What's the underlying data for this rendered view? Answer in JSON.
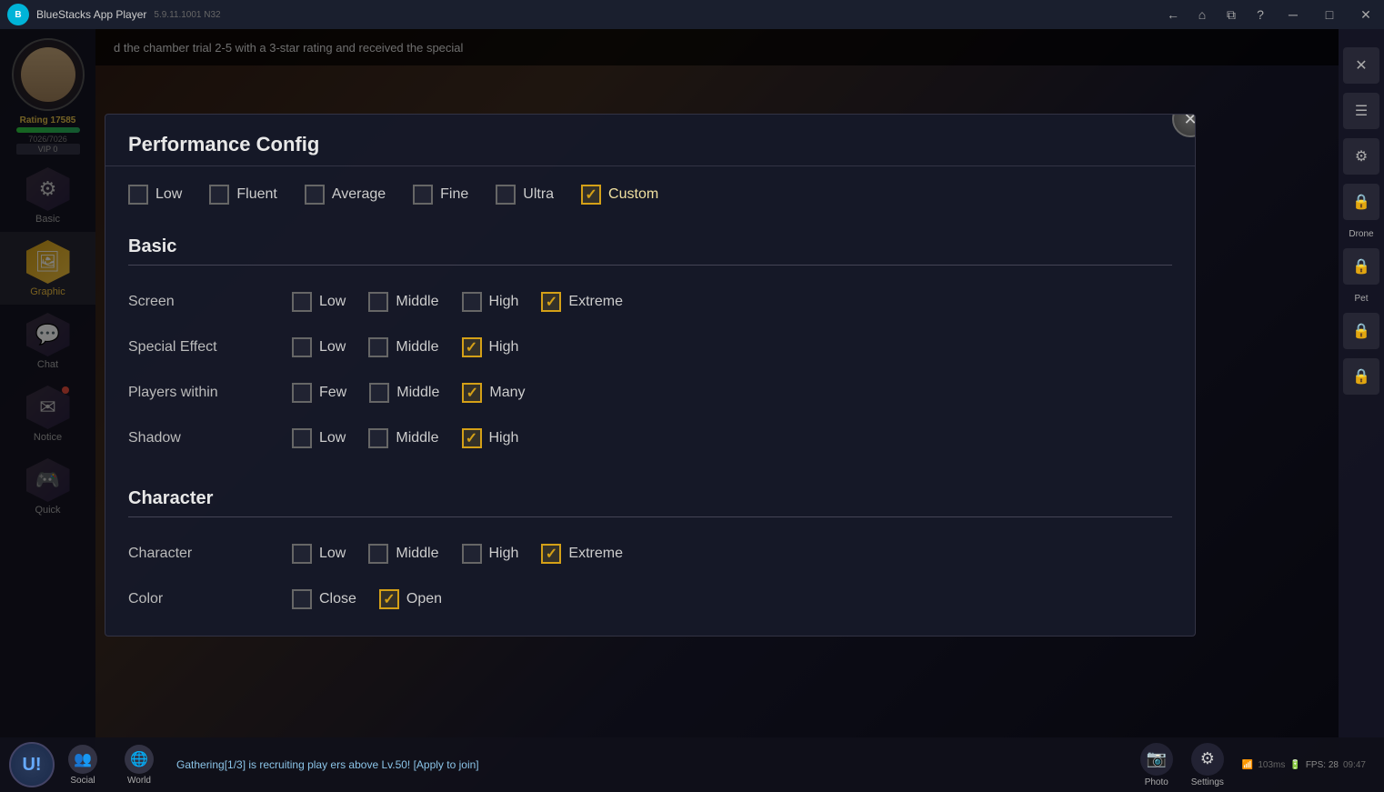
{
  "app": {
    "title": "BlueStacks App Player",
    "version": "5.9.11.1001 N32",
    "close_btn": "✕",
    "minimize_btn": "─",
    "maximize_btn": "□",
    "help_btn": "?",
    "back_icon": "←",
    "home_icon": "⌂",
    "recent_icon": "⧉"
  },
  "titlebar": {
    "title": "BlueStacks App Player",
    "version": "5.9.11.1001 N32"
  },
  "player": {
    "rating_label": "Rating",
    "rating": "17585",
    "hp_current": "7026",
    "hp_max": "7026",
    "vip": "VIP 0"
  },
  "notification": {
    "text": "d the chamber trial 2-5 with a 3-star rating and received the special"
  },
  "left_nav": {
    "items": [
      {
        "id": "basic",
        "label": "Basic",
        "icon": "⚙",
        "active": false
      },
      {
        "id": "graphic",
        "label": "Graphic",
        "icon": "🖼",
        "active": true
      },
      {
        "id": "chat",
        "label": "Chat",
        "icon": "💬",
        "active": false
      },
      {
        "id": "notice",
        "label": "Notice",
        "icon": "✉",
        "active": false
      },
      {
        "id": "quick",
        "label": "Quick",
        "icon": "🎮",
        "active": false
      }
    ]
  },
  "right_nav": {
    "items": [
      {
        "id": "close-x",
        "icon": "✕",
        "locked": false
      },
      {
        "id": "nav1",
        "icon": "☰",
        "locked": false
      },
      {
        "id": "nav2",
        "icon": "⚙",
        "locked": true
      },
      {
        "id": "nav3",
        "icon": "🔒",
        "locked": true
      },
      {
        "id": "drone",
        "label": "Drone",
        "icon": "🔒",
        "locked": true
      },
      {
        "id": "pet",
        "label": "Pet",
        "icon": "🔒",
        "locked": true
      },
      {
        "id": "nav6",
        "icon": "🔒",
        "locked": true
      }
    ]
  },
  "modal": {
    "title": "Performance Config",
    "close_btn": "✕",
    "presets": [
      {
        "id": "low",
        "label": "Low",
        "checked": false
      },
      {
        "id": "fluent",
        "label": "Fluent",
        "checked": false
      },
      {
        "id": "average",
        "label": "Average",
        "checked": false
      },
      {
        "id": "fine",
        "label": "Fine",
        "checked": false
      },
      {
        "id": "ultra",
        "label": "Ultra",
        "checked": false
      },
      {
        "id": "custom",
        "label": "Custom",
        "checked": true
      }
    ],
    "sections": {
      "basic": {
        "title": "Basic",
        "rows": [
          {
            "id": "screen",
            "label": "Screen",
            "options": [
              {
                "id": "low",
                "label": "Low",
                "checked": false
              },
              {
                "id": "middle",
                "label": "Middle",
                "checked": false
              },
              {
                "id": "high",
                "label": "High",
                "checked": false
              },
              {
                "id": "extreme",
                "label": "Extreme",
                "checked": true
              }
            ]
          },
          {
            "id": "special_effect",
            "label": "Special Effect",
            "options": [
              {
                "id": "low",
                "label": "Low",
                "checked": false
              },
              {
                "id": "middle",
                "label": "Middle",
                "checked": false
              },
              {
                "id": "high",
                "label": "High",
                "checked": true
              }
            ]
          },
          {
            "id": "players_within",
            "label": "Players within",
            "options": [
              {
                "id": "few",
                "label": "Few",
                "checked": false
              },
              {
                "id": "middle",
                "label": "Middle",
                "checked": false
              },
              {
                "id": "many",
                "label": "Many",
                "checked": true
              }
            ]
          },
          {
            "id": "shadow",
            "label": "Shadow",
            "options": [
              {
                "id": "low",
                "label": "Low",
                "checked": false
              },
              {
                "id": "middle",
                "label": "Middle",
                "checked": false
              },
              {
                "id": "high",
                "label": "High",
                "checked": true
              }
            ]
          }
        ]
      },
      "character": {
        "title": "Character",
        "rows": [
          {
            "id": "character",
            "label": "Character",
            "options": [
              {
                "id": "low",
                "label": "Low",
                "checked": false
              },
              {
                "id": "middle",
                "label": "Middle",
                "checked": false
              },
              {
                "id": "high",
                "label": "High",
                "checked": false
              },
              {
                "id": "extreme",
                "label": "Extreme",
                "checked": true
              }
            ]
          },
          {
            "id": "color",
            "label": "Color",
            "options": [
              {
                "id": "close",
                "label": "Close",
                "checked": false
              },
              {
                "id": "open",
                "label": "Open",
                "checked": true
              }
            ]
          }
        ]
      }
    }
  },
  "bottom": {
    "social_label": "Social",
    "world_label": "World",
    "chat_message": "Gathering[1/3] is recruiting play ers above Lv.50! [Apply to join]",
    "photo_label": "Photo",
    "settings_label": "Settings",
    "time": "09:47",
    "signal": "103ms",
    "fps": "FPS: 28"
  }
}
